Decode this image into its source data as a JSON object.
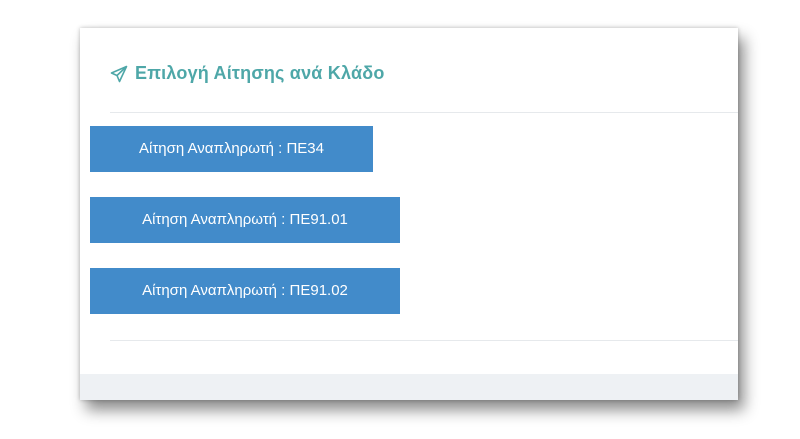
{
  "panel": {
    "title": "Επιλογή Αίτησης ανά Κλάδο",
    "title_icon": "paper-plane-icon",
    "accent_color": "#4ea7a8",
    "button_color": "#428bca"
  },
  "buttons": [
    {
      "label": "Αίτηση Αναπληρωτή : ΠΕ34"
    },
    {
      "label": "Αίτηση Αναπληρωτή : ΠΕ91.01"
    },
    {
      "label": "Αίτηση Αναπληρωτή : ΠΕ91.02"
    }
  ]
}
